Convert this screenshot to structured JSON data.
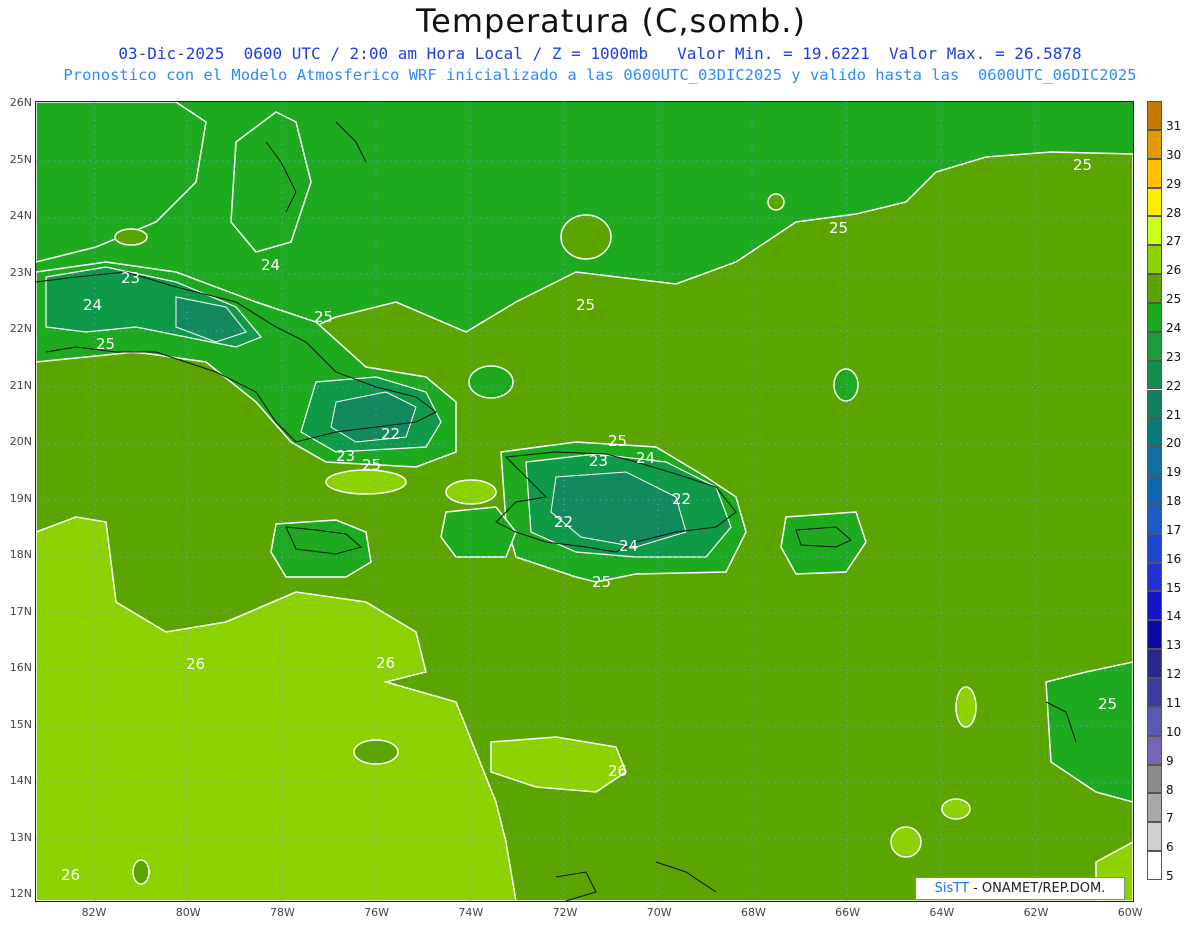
{
  "header": {
    "title": "Temperatura (C,somb.)",
    "subtitle_line1": "03-Dic-2025  0600 UTC / 2:00 am Hora Local / Z = 1000mb   Valor Min. = 19.6221  Valor Max. = 26.5878",
    "subtitle_line2": "Pronostico con el Modelo Atmosferico WRF inicializado a las 0600UTC_03DIC2025 y valido hasta las  0600UTC_06DIC2025"
  },
  "axes": {
    "lat_labels": [
      "26N",
      "25N",
      "24N",
      "23N",
      "22N",
      "21N",
      "20N",
      "19N",
      "18N",
      "17N",
      "16N",
      "15N",
      "14N",
      "13N",
      "12N"
    ],
    "lon_labels": [
      "82W",
      "80W",
      "78W",
      "76W",
      "74W",
      "72W",
      "70W",
      "68W",
      "66W",
      "64W",
      "62W",
      "60W"
    ]
  },
  "colorbar": {
    "levels": [
      "31",
      "30",
      "29",
      "28",
      "27",
      "26",
      "25",
      "24",
      "23",
      "22",
      "21",
      "20",
      "19",
      "18",
      "17",
      "16",
      "15",
      "14",
      "13",
      "12",
      "11",
      "10",
      "9",
      "8",
      "7",
      "6",
      "5"
    ],
    "colors": [
      "#c27a00",
      "#e19a00",
      "#ffc000",
      "#ffee00",
      "#c8ff1e",
      "#8cd200",
      "#5aa500",
      "#1eaa1e",
      "#1e9a3c",
      "#168c50",
      "#128060",
      "#0c7878",
      "#1070a0",
      "#1464b4",
      "#1e5ac8",
      "#1e46d2",
      "#1e32d2",
      "#1414c8",
      "#0a0aa0",
      "#28288c",
      "#3c3ca0",
      "#5a5ab4",
      "#7864b4",
      "#8c8c8c",
      "#a8a8a8",
      "#d0d0d0",
      "#ffffff"
    ]
  },
  "map": {
    "contour_labels": [
      "24",
      "23",
      "24",
      "25",
      "25",
      "25",
      "25",
      "25",
      "22",
      "23",
      "25",
      "25",
      "23",
      "24",
      "22",
      "22",
      "24",
      "25",
      "26",
      "26",
      "26",
      "26",
      "25"
    ],
    "field_colors": {
      "t24": "#1eaa1e",
      "t25": "#5aa500",
      "t26": "#8cd200",
      "t23": "#0f9a48",
      "t22": "#128a5e"
    }
  },
  "credit": {
    "brand": "SisTT",
    "text": " - ONAMET/REP.DOM."
  }
}
